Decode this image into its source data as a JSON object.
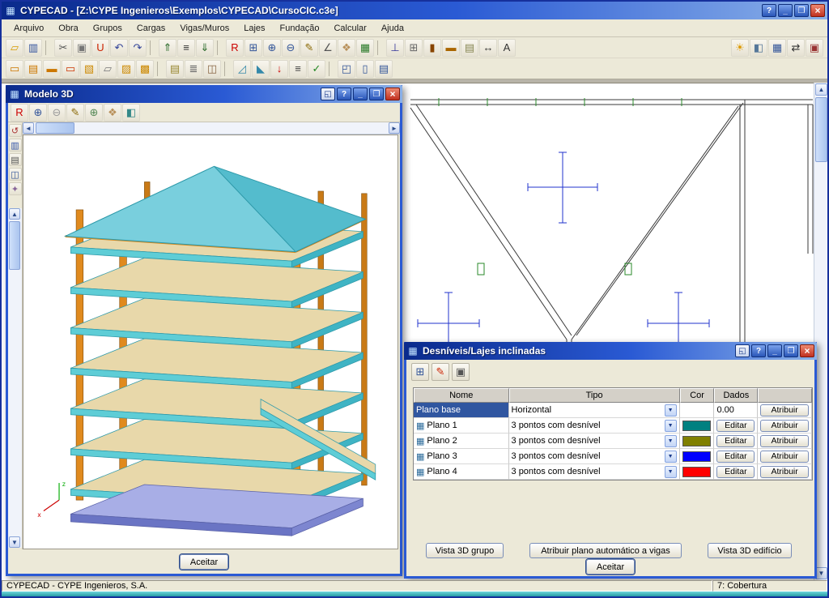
{
  "window": {
    "title": "CYPECAD - [Z:\\CYPE Ingenieros\\Exemplos\\CYPECAD\\CursoCIC.c3e]",
    "buttons": {
      "help": "?",
      "min": "_",
      "max": "❐",
      "close": "×"
    },
    "menu": [
      {
        "n": "menu-arquivo",
        "g": "Arquivo"
      },
      {
        "n": "menu-obra",
        "g": "Obra"
      },
      {
        "n": "menu-grupos",
        "g": "Grupos"
      },
      {
        "n": "menu-cargas",
        "g": "Cargas"
      },
      {
        "n": "menu-vigas-muros",
        "g": "Vigas/Muros"
      },
      {
        "n": "menu-lajes",
        "g": "Lajes"
      },
      {
        "n": "menu-fundacao",
        "g": "Fundação"
      },
      {
        "n": "menu-calcular",
        "g": "Calcular"
      },
      {
        "n": "menu-ajuda",
        "g": "Ajuda"
      }
    ]
  },
  "icons": {
    "win_icon": "▦",
    "detach": "◱",
    "toolbar1": [
      {
        "n": "open-icon",
        "g": "▱",
        "c": "#d79b00"
      },
      {
        "n": "save-icon",
        "g": "▥",
        "c": "#33539e"
      },
      {
        "n": "separator",
        "g": ""
      },
      {
        "n": "cut-icon",
        "g": "✂",
        "c": "#555555"
      },
      {
        "n": "copy-icon",
        "g": "▣",
        "c": "#777777"
      },
      {
        "n": "magnet-icon",
        "g": "U",
        "c": "#cc2200"
      },
      {
        "n": "undo-icon",
        "g": "↶",
        "c": "#334499"
      },
      {
        "n": "redo-icon",
        "g": "↷",
        "c": "#334499"
      },
      {
        "n": "separator",
        "g": ""
      },
      {
        "n": "group-up-icon",
        "g": "⇑",
        "c": "#2a6a2a"
      },
      {
        "n": "group-list-icon",
        "g": "≡",
        "c": "#333333"
      },
      {
        "n": "group-down-icon",
        "g": "⇓",
        "c": "#2a6a2a"
      },
      {
        "n": "separator",
        "g": ""
      },
      {
        "n": "rotate-view-icon",
        "g": "R",
        "c": "#cc0000"
      },
      {
        "n": "zoom-window-icon",
        "g": "⊞",
        "c": "#335599"
      },
      {
        "n": "zoom-in-icon",
        "g": "⊕",
        "c": "#335599"
      },
      {
        "n": "zoom-out-icon",
        "g": "⊖",
        "c": "#335599"
      },
      {
        "n": "redraw-icon",
        "g": "✎",
        "c": "#886600"
      },
      {
        "n": "measure-icon",
        "g": "∠",
        "c": "#555555"
      },
      {
        "n": "pan-icon",
        "g": "❖",
        "c": "#b8905a"
      },
      {
        "n": "mesh-icon",
        "g": "▦",
        "c": "#2a7a2a"
      },
      {
        "n": "separator",
        "g": ""
      },
      {
        "n": "axes-icon",
        "g": "⊥",
        "c": "#333399"
      },
      {
        "n": "grid-icon",
        "g": "⊞",
        "c": "#666666"
      },
      {
        "n": "column-tool-icon",
        "g": "▮",
        "c": "#884400"
      },
      {
        "n": "beam-tool-icon",
        "g": "▬",
        "c": "#aa6600"
      },
      {
        "n": "wall-tool-icon",
        "g": "▤",
        "c": "#888855"
      },
      {
        "n": "dimension-icon",
        "g": "↔",
        "c": "#333333"
      },
      {
        "n": "text-icon",
        "g": "A",
        "c": "#333333"
      }
    ],
    "toolbar1_right": [
      {
        "n": "light-icon",
        "g": "☀",
        "c": "#dd9900"
      },
      {
        "n": "render-icon",
        "g": "◧",
        "c": "#557799"
      },
      {
        "n": "tables-icon",
        "g": "▦",
        "c": "#335599"
      },
      {
        "n": "transfer-icon",
        "g": "⇄",
        "c": "#333333"
      },
      {
        "n": "exit-icon",
        "g": "▣",
        "c": "#993333"
      }
    ],
    "toolbar2": [
      {
        "n": "entry-beams-icon",
        "g": "▭",
        "c": "#cc7700"
      },
      {
        "n": "adjust-beams-icon",
        "g": "▤",
        "c": "#cc7700"
      },
      {
        "n": "extend-beam-icon",
        "g": "▬",
        "c": "#cc7700"
      },
      {
        "n": "delete-beam-icon",
        "g": "▭",
        "c": "#cc3300"
      },
      {
        "n": "slab-panel-icon",
        "g": "▧",
        "c": "#cc8800"
      },
      {
        "n": "slab-hole-icon",
        "g": "▱",
        "c": "#777777"
      },
      {
        "n": "slab-edit-icon",
        "g": "▨",
        "c": "#cc8800"
      },
      {
        "n": "slab-copy-icon",
        "g": "▩",
        "c": "#cc8800"
      },
      {
        "n": "separator",
        "g": ""
      },
      {
        "n": "wall-define-icon",
        "g": "▤",
        "c": "#998833"
      },
      {
        "n": "stairs-icon",
        "g": "≣",
        "c": "#666666"
      },
      {
        "n": "foundation-icon",
        "g": "◫",
        "c": "#886644"
      },
      {
        "n": "separator",
        "g": ""
      },
      {
        "n": "slope-plane-icon",
        "g": "◿",
        "c": "#3388aa"
      },
      {
        "n": "desnivel-icon",
        "g": "◣",
        "c": "#3388aa"
      },
      {
        "n": "loads-icon",
        "g": "↓",
        "c": "#cc0000"
      },
      {
        "n": "reinforcement-icon",
        "g": "≡",
        "c": "#444444"
      },
      {
        "n": "check-icon",
        "g": "✓",
        "c": "#228822"
      },
      {
        "n": "separator",
        "g": ""
      },
      {
        "n": "views-icon",
        "g": "◰",
        "c": "#335599"
      },
      {
        "n": "drawings-icon",
        "g": "▯",
        "c": "#335599"
      },
      {
        "n": "report-icon",
        "g": "▤",
        "c": "#335599"
      }
    ],
    "m3d_toolbar": [
      {
        "n": "rotate-3d-icon",
        "g": "R",
        "c": "#cc0000"
      },
      {
        "n": "zoom-extents-icon",
        "g": "⊕",
        "c": "#335599"
      },
      {
        "n": "zoom-prev-icon",
        "g": "⊖",
        "c": "#999999"
      },
      {
        "n": "section-icon",
        "g": "✎",
        "c": "#886600"
      },
      {
        "n": "zoom-in-3d-icon",
        "g": "⊕",
        "c": "#558855"
      },
      {
        "n": "pan-3d-icon",
        "g": "❖",
        "c": "#b8905a"
      },
      {
        "n": "solid-view-icon",
        "g": "◧",
        "c": "#338888"
      }
    ],
    "m3d_strip": [
      {
        "n": "rotate-left-icon",
        "g": "↺",
        "c": "#aa3333"
      },
      {
        "n": "levels-icon",
        "g": "▥",
        "c": "#3355aa"
      },
      {
        "n": "print-3d-icon",
        "g": "▤",
        "c": "#555555"
      },
      {
        "n": "capture-icon",
        "g": "◫",
        "c": "#335599"
      },
      {
        "n": "options-icon",
        "g": "✦",
        "c": "#886699"
      }
    ],
    "dlg_toolbar": [
      {
        "n": "add-plane-icon",
        "g": "⊞",
        "c": "#335599"
      },
      {
        "n": "delete-plane-icon",
        "g": "✎",
        "c": "#cc2200"
      },
      {
        "n": "copy-plane-icon",
        "g": "▣",
        "c": "#555555"
      }
    ]
  },
  "modelo3d": {
    "title": "Modelo 3D",
    "aceitar": "Aceitar"
  },
  "dialog": {
    "title": "Desníveis/Lajes inclinadas",
    "columns": {
      "nome": "Nome",
      "tipo": "Tipo",
      "cor": "Cor",
      "dados": "Dados"
    },
    "rows": [
      {
        "nome": "Plano base",
        "tipo": "Horizontal",
        "dados": "0.00",
        "atribuir": "Atribuir"
      },
      {
        "nome": "Plano 1",
        "tipo": "3 pontos com desnível",
        "cor": "#008080",
        "editar": "Editar",
        "atribuir": "Atribuir"
      },
      {
        "nome": "Plano 2",
        "tipo": "3 pontos com desnível",
        "cor": "#808000",
        "editar": "Editar",
        "atribuir": "Atribuir"
      },
      {
        "nome": "Plano 3",
        "tipo": "3 pontos com desnível",
        "cor": "#0000ff",
        "editar": "Editar",
        "atribuir": "Atribuir"
      },
      {
        "nome": "Plano 4",
        "tipo": "3 pontos com desnível",
        "cor": "#ff0000",
        "editar": "Editar",
        "atribuir": "Atribuir"
      }
    ],
    "buttons": {
      "vista_grupo": "Vista 3D grupo",
      "atribuir_auto": "Atribuir plano automático a vigas",
      "vista_edificio": "Vista 3D edifício",
      "aceitar": "Aceitar"
    }
  },
  "statusbar": {
    "left": "CYPECAD - CYPE Ingenieros, S.A.",
    "right": "7: Cobertura"
  }
}
